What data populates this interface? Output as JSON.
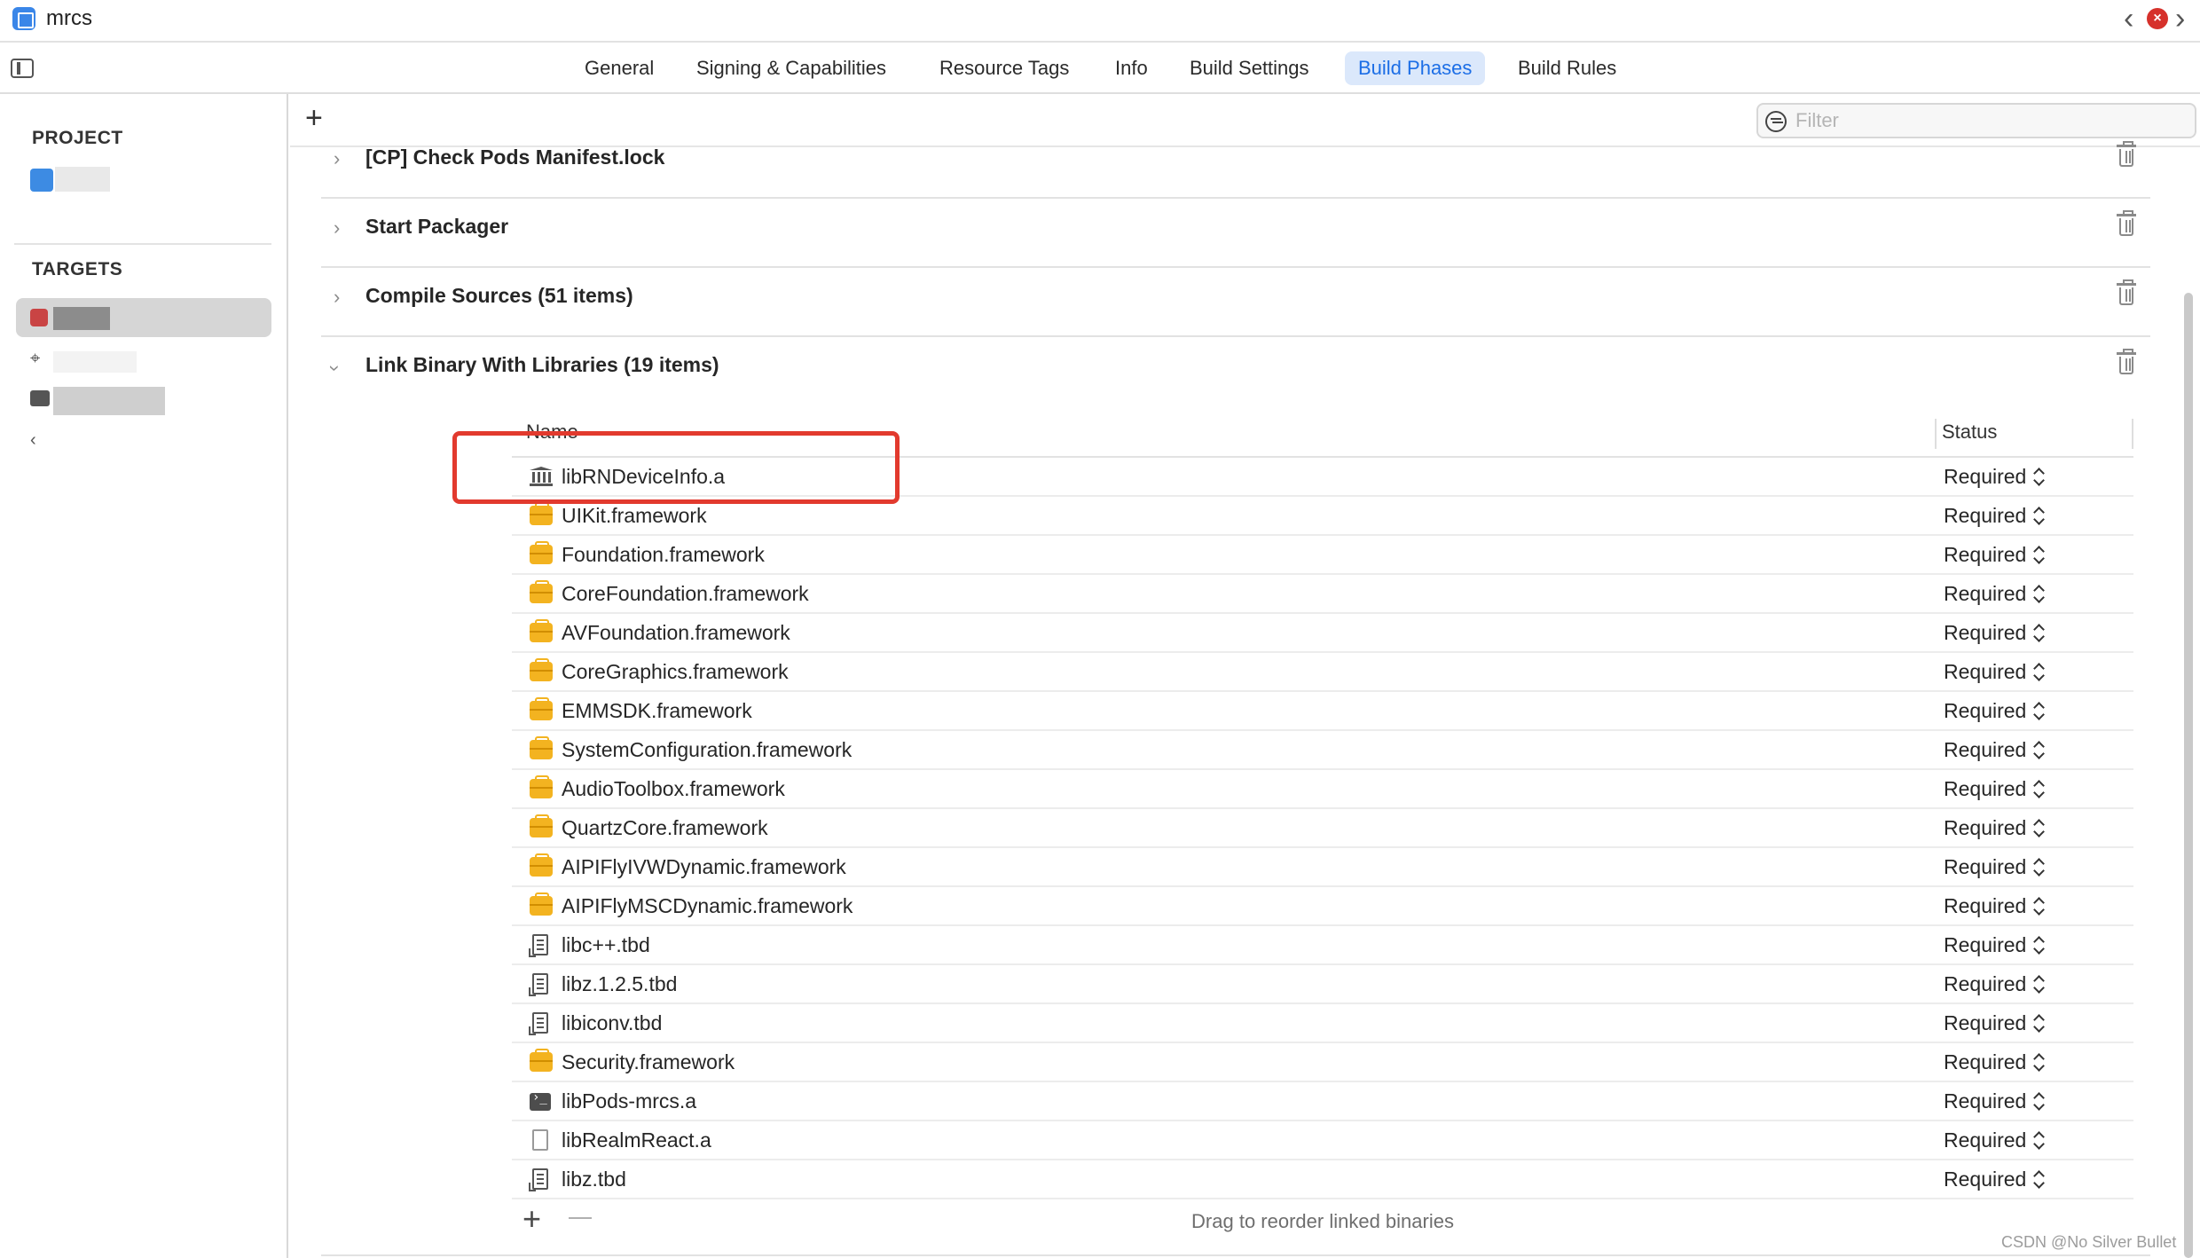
{
  "window": {
    "title": "mrcs",
    "accent_color": "#1c6ee6"
  },
  "tabs": [
    {
      "label": "General",
      "active": false
    },
    {
      "label": "Signing & Capabilities",
      "active": false
    },
    {
      "label": "Resource Tags",
      "active": false
    },
    {
      "label": "Info",
      "active": false
    },
    {
      "label": "Build Settings",
      "active": false
    },
    {
      "label": "Build Phases",
      "active": true
    },
    {
      "label": "Build Rules",
      "active": false
    }
  ],
  "sidebar": {
    "project_heading": "PROJECT",
    "targets_heading": "TARGETS"
  },
  "toolbar": {
    "add_label": "+",
    "filter_placeholder": "Filter"
  },
  "phases": [
    {
      "title": "[CP] Check Pods Manifest.lock",
      "expanded": false
    },
    {
      "title": "Start Packager",
      "expanded": false
    },
    {
      "title": "Compile Sources (51 items)",
      "expanded": false
    },
    {
      "title": "Link Binary With Libraries (19 items)",
      "expanded": true
    }
  ],
  "libraries": {
    "columns": {
      "name": "Name",
      "status": "Status"
    },
    "items": [
      {
        "name": "libRNDeviceInfo.a",
        "status": "Required",
        "icon": "library-icon"
      },
      {
        "name": "UIKit.framework",
        "status": "Required",
        "icon": "framework-icon"
      },
      {
        "name": "Foundation.framework",
        "status": "Required",
        "icon": "framework-icon"
      },
      {
        "name": "CoreFoundation.framework",
        "status": "Required",
        "icon": "framework-icon"
      },
      {
        "name": "AVFoundation.framework",
        "status": "Required",
        "icon": "framework-icon"
      },
      {
        "name": "CoreGraphics.framework",
        "status": "Required",
        "icon": "framework-icon"
      },
      {
        "name": "EMMSDK.framework",
        "status": "Required",
        "icon": "framework-icon"
      },
      {
        "name": "SystemConfiguration.framework",
        "status": "Required",
        "icon": "framework-icon"
      },
      {
        "name": "AudioToolbox.framework",
        "status": "Required",
        "icon": "framework-icon"
      },
      {
        "name": "QuartzCore.framework",
        "status": "Required",
        "icon": "framework-icon"
      },
      {
        "name": "AIPIFlyIVWDynamic.framework",
        "status": "Required",
        "icon": "framework-icon"
      },
      {
        "name": "AIPIFlyMSCDynamic.framework",
        "status": "Required",
        "icon": "framework-icon"
      },
      {
        "name": "libc++.tbd",
        "status": "Required",
        "icon": "tbd-icon"
      },
      {
        "name": "libz.1.2.5.tbd",
        "status": "Required",
        "icon": "tbd-icon"
      },
      {
        "name": "libiconv.tbd",
        "status": "Required",
        "icon": "tbd-icon"
      },
      {
        "name": "Security.framework",
        "status": "Required",
        "icon": "framework-icon"
      },
      {
        "name": "libPods-mrcs.a",
        "status": "Required",
        "icon": "terminal-icon"
      },
      {
        "name": "libRealmReact.a",
        "status": "Required",
        "icon": "file-icon"
      },
      {
        "name": "libz.tbd",
        "status": "Required",
        "icon": "tbd-icon"
      }
    ],
    "footer_hint": "Drag to reorder linked binaries",
    "add_label": "+"
  },
  "annotation": {
    "highlight_color": "#e23a2e"
  },
  "watermark": "CSDN @No Silver Bullet"
}
